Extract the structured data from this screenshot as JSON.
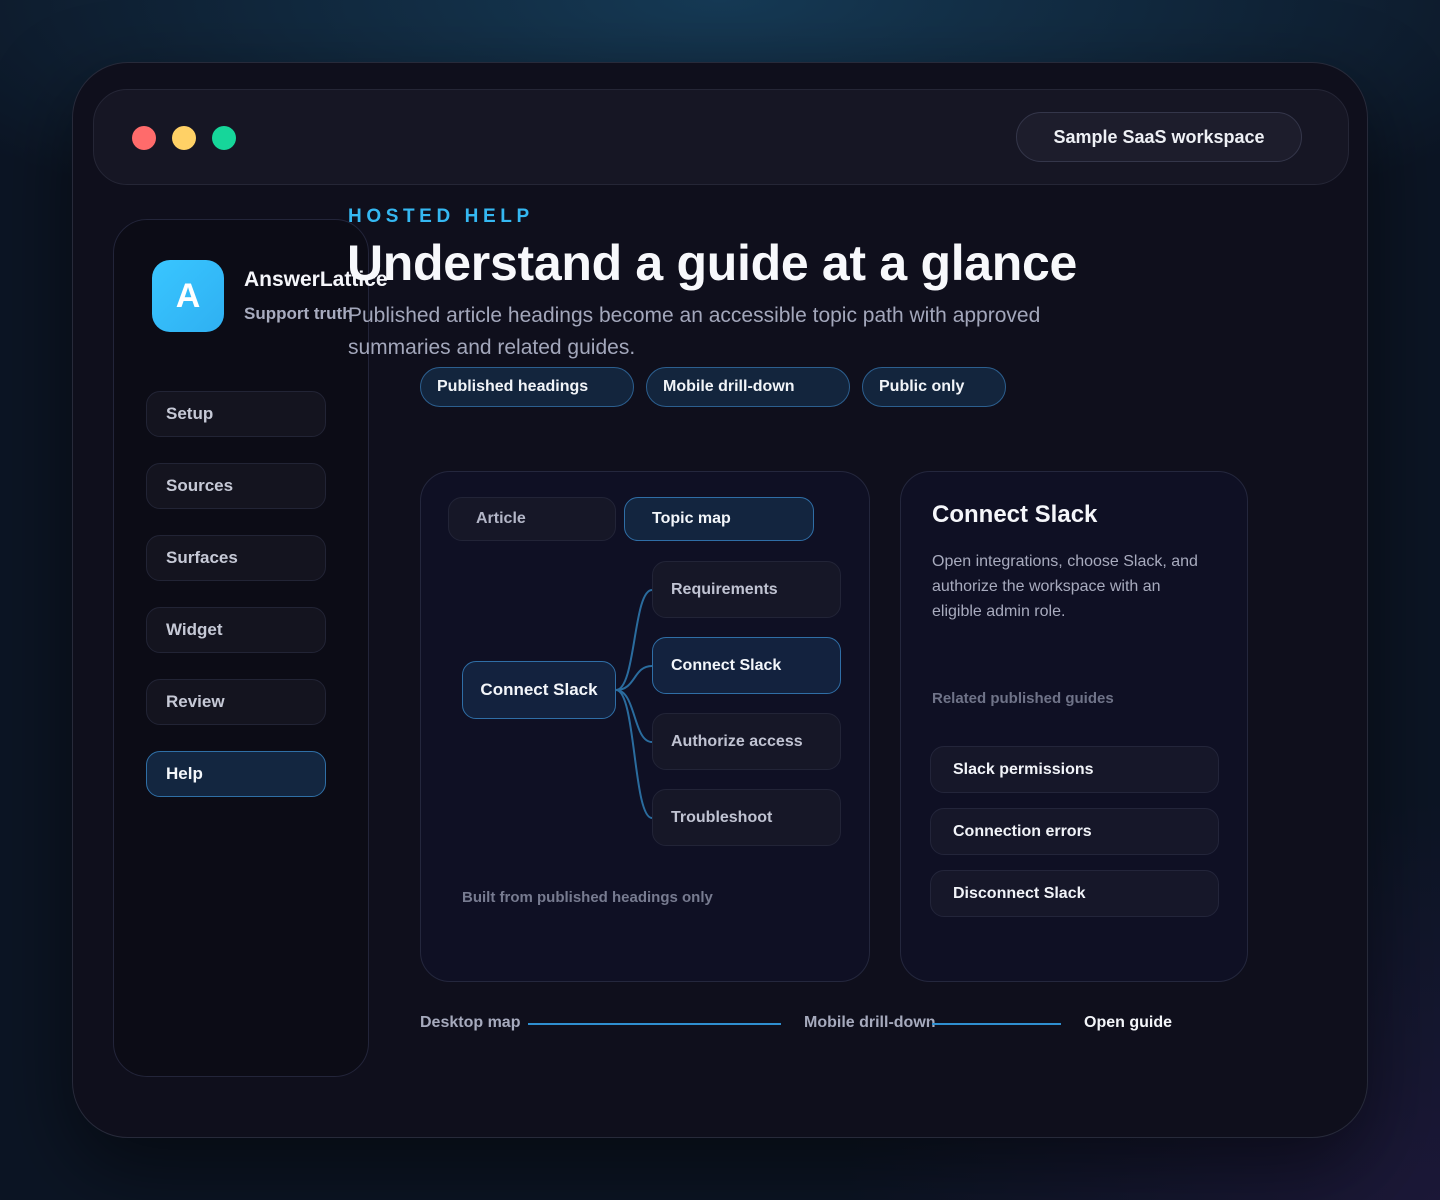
{
  "window": {
    "workspace_label": "Sample SaaS workspace"
  },
  "sidebar": {
    "logo_letter": "A",
    "brand_name": "AnswerLattice",
    "brand_tagline": "Support truth",
    "items": [
      {
        "label": "Setup"
      },
      {
        "label": "Sources"
      },
      {
        "label": "Surfaces"
      },
      {
        "label": "Widget"
      },
      {
        "label": "Review"
      },
      {
        "label": "Help",
        "active": true
      }
    ]
  },
  "hero": {
    "eyebrow": "HOSTED HELP",
    "title": "Understand a guide at a glance",
    "subtitle": "Published article headings become an accessible topic path with approved summaries and related guides."
  },
  "chips": [
    {
      "label": "Published headings"
    },
    {
      "label": "Mobile drill-down"
    },
    {
      "label": "Public only"
    }
  ],
  "map_panel": {
    "tabs": [
      {
        "label": "Article",
        "active": false
      },
      {
        "label": "Topic map",
        "active": true
      }
    ],
    "root": "Connect Slack",
    "children": [
      {
        "label": "Requirements",
        "active": false
      },
      {
        "label": "Connect Slack",
        "active": true
      },
      {
        "label": "Authorize access",
        "active": false
      },
      {
        "label": "Troubleshoot",
        "active": false
      }
    ],
    "footnote": "Built from published headings only"
  },
  "detail_panel": {
    "title": "Connect Slack",
    "body": "Open integrations, choose Slack, and authorize the workspace with an eligible admin role.",
    "related_label": "Related published guides",
    "guides": [
      {
        "label": "Slack permissions"
      },
      {
        "label": "Connection errors"
      },
      {
        "label": "Disconnect Slack"
      }
    ]
  },
  "flow": {
    "steps": [
      "Desktop map",
      "Mobile drill-down",
      "Open guide"
    ]
  },
  "colors": {
    "accent": "#35b8f2",
    "active_border": "#2f6ea6",
    "traffic_red": "#ff6b6b",
    "traffic_yellow": "#ffd166",
    "traffic_green": "#16d69a"
  }
}
